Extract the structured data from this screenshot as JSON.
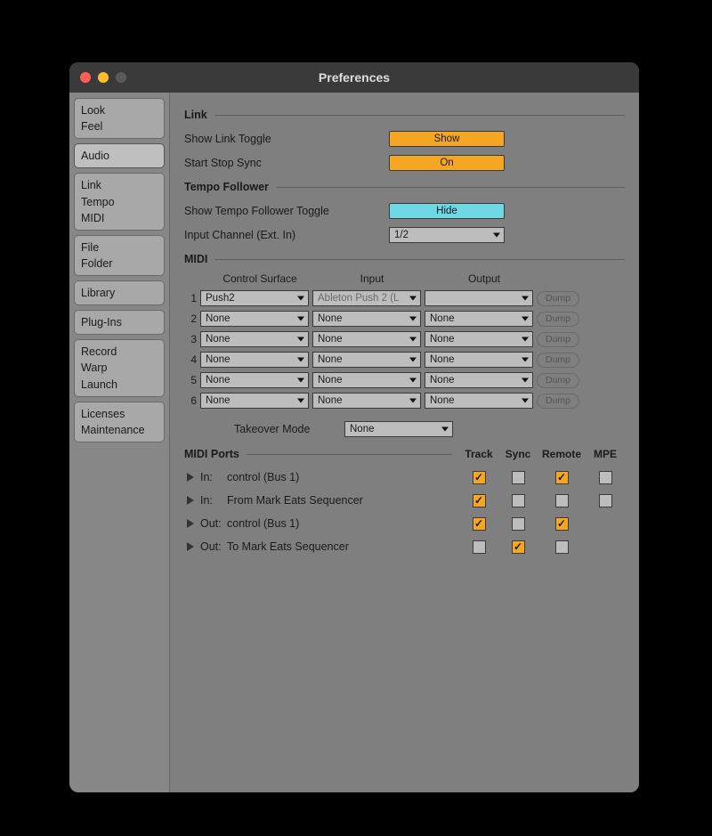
{
  "window": {
    "title": "Preferences"
  },
  "sidebar": {
    "tabs": [
      {
        "id": "look-feel",
        "lines": [
          "Look",
          "Feel"
        ],
        "active": false
      },
      {
        "id": "audio",
        "lines": [
          "Audio"
        ],
        "active": true
      },
      {
        "id": "link-tempo-midi",
        "lines": [
          "Link",
          "Tempo",
          "MIDI"
        ],
        "active": false
      },
      {
        "id": "file-folder",
        "lines": [
          "File",
          "Folder"
        ],
        "active": false
      },
      {
        "id": "library",
        "lines": [
          "Library"
        ],
        "active": false
      },
      {
        "id": "plug-ins",
        "lines": [
          "Plug-Ins"
        ],
        "active": false
      },
      {
        "id": "record-warp-launch",
        "lines": [
          "Record",
          "Warp",
          "Launch"
        ],
        "active": false
      },
      {
        "id": "licenses-maintenance",
        "lines": [
          "Licenses",
          "Maintenance"
        ],
        "active": false
      }
    ]
  },
  "sections": {
    "link": {
      "header": "Link",
      "show_toggle_label": "Show Link Toggle",
      "show_toggle_value": "Show",
      "start_stop_label": "Start Stop Sync",
      "start_stop_value": "On"
    },
    "tempo": {
      "header": "Tempo Follower",
      "show_toggle_label": "Show Tempo Follower Toggle",
      "show_toggle_value": "Hide",
      "input_channel_label": "Input Channel (Ext. In)",
      "input_channel_value": "1/2"
    },
    "midi": {
      "header": "MIDI",
      "col_control": "Control Surface",
      "col_input": "Input",
      "col_output": "Output",
      "dump_label": "Dump",
      "rows": [
        {
          "n": "1",
          "control": "Push2",
          "input": "Ableton Push 2 (L",
          "input_disabled": true,
          "output": ""
        },
        {
          "n": "2",
          "control": "None",
          "input": "None",
          "output": "None"
        },
        {
          "n": "3",
          "control": "None",
          "input": "None",
          "output": "None"
        },
        {
          "n": "4",
          "control": "None",
          "input": "None",
          "output": "None"
        },
        {
          "n": "5",
          "control": "None",
          "input": "None",
          "output": "None"
        },
        {
          "n": "6",
          "control": "None",
          "input": "None",
          "output": "None"
        }
      ],
      "takeover_label": "Takeover Mode",
      "takeover_value": "None"
    },
    "ports": {
      "header": "MIDI Ports",
      "col_track": "Track",
      "col_sync": "Sync",
      "col_remote": "Remote",
      "col_mpe": "MPE",
      "rows": [
        {
          "dir": "In:",
          "name": "control (Bus 1)",
          "track": true,
          "sync": false,
          "remote": true,
          "mpe": false,
          "has_mpe": true
        },
        {
          "dir": "In:",
          "name": "From Mark Eats Sequencer",
          "track": true,
          "sync": false,
          "remote": false,
          "mpe": false,
          "has_mpe": true
        },
        {
          "dir": "Out:",
          "name": "control (Bus 1)",
          "track": true,
          "sync": false,
          "remote": true,
          "mpe": false,
          "has_mpe": false
        },
        {
          "dir": "Out:",
          "name": "To Mark Eats Sequencer",
          "track": false,
          "sync": true,
          "remote": false,
          "mpe": false,
          "has_mpe": false
        }
      ]
    }
  }
}
